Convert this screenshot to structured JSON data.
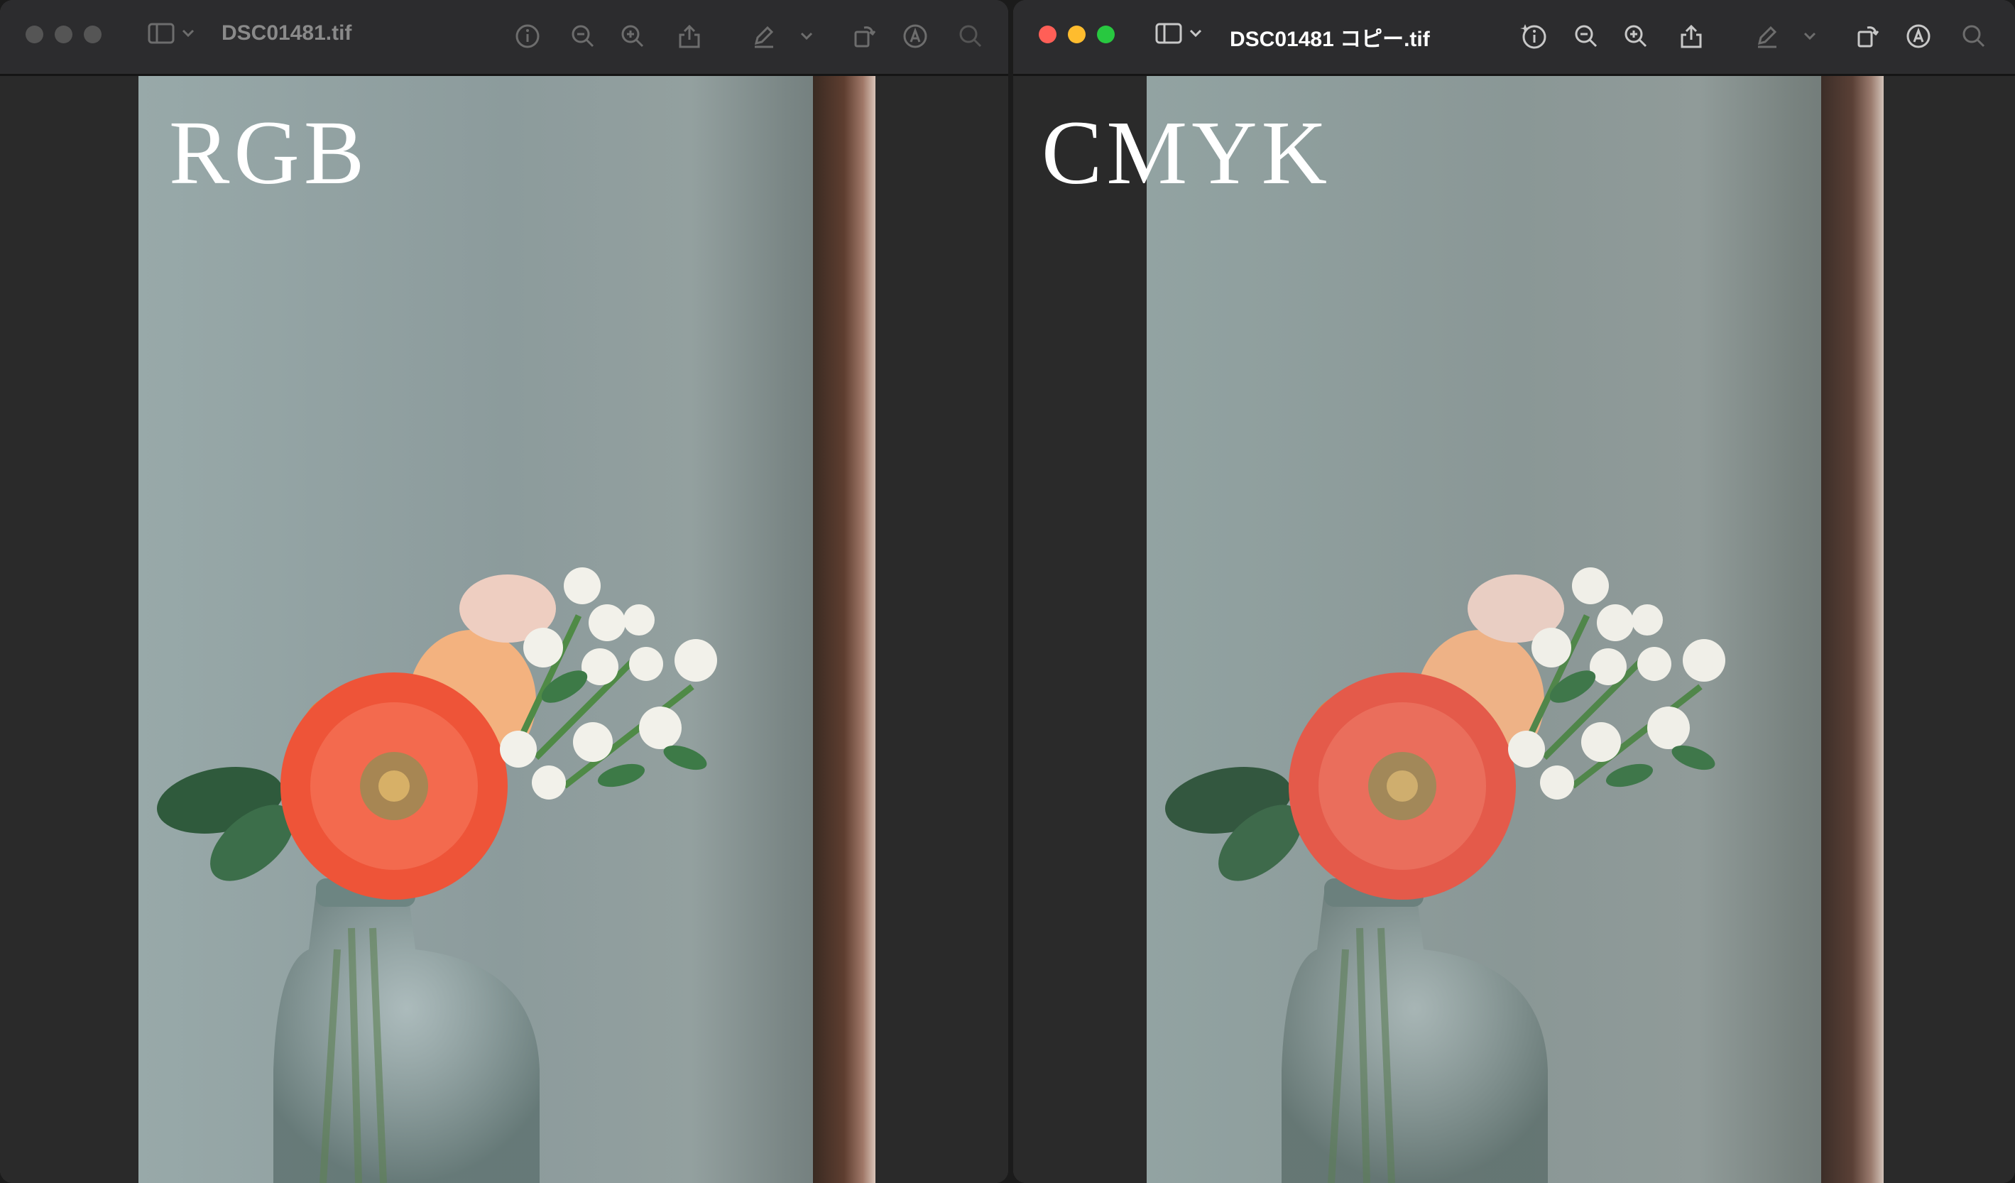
{
  "left_window": {
    "title": "DSC01481.tif",
    "label": "RGB",
    "active": false
  },
  "right_window": {
    "title": "DSC01481 コピー.tif",
    "label": "CMYK",
    "active": true
  },
  "toolbar_icons": [
    "sidebar-icon",
    "chevron-down-icon",
    "info-icon",
    "zoom-out-icon",
    "zoom-in-icon",
    "share-icon",
    "markup-icon",
    "chevron-down-icon",
    "rotate-icon",
    "annotate-icon",
    "search-icon"
  ],
  "colors": {
    "close": "#ff5f57",
    "minimize": "#febc2e",
    "zoom": "#28c840",
    "inactive_light": "#555555",
    "active_title": "#ffffff",
    "inactive_title": "#8a8a8a"
  }
}
